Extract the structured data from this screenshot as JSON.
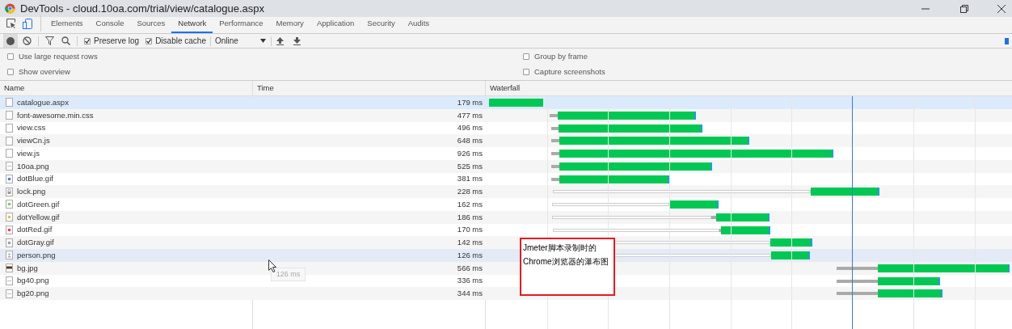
{
  "window": {
    "title": "DevTools - cloud.10oa.com/trial/view/catalogue.aspx"
  },
  "tabs": [
    {
      "label": "Elements",
      "selected": false
    },
    {
      "label": "Console",
      "selected": false
    },
    {
      "label": "Sources",
      "selected": false
    },
    {
      "label": "Network",
      "selected": true
    },
    {
      "label": "Performance",
      "selected": false
    },
    {
      "label": "Memory",
      "selected": false
    },
    {
      "label": "Application",
      "selected": false
    },
    {
      "label": "Security",
      "selected": false
    },
    {
      "label": "Audits",
      "selected": false
    }
  ],
  "toolbar": {
    "recording": true,
    "preserve_log": {
      "label": "Preserve log",
      "checked": true
    },
    "disable_cache": {
      "label": "Disable cache",
      "checked": true
    },
    "throttling": "Online"
  },
  "options": [
    {
      "label": "Use large request rows",
      "checked": false
    },
    {
      "label": "Group by frame",
      "checked": false
    },
    {
      "label": "Show overview",
      "checked": false
    },
    {
      "label": "Capture screenshots",
      "checked": false
    }
  ],
  "table": {
    "columns": [
      "Name",
      "Time",
      "Waterfall"
    ],
    "rows": [
      {
        "name": "catalogue.aspx",
        "time": "179 ms",
        "kind": "doc",
        "selected": true,
        "hovered": false
      },
      {
        "name": "font-awesome.min.css",
        "time": "477 ms",
        "kind": "doc",
        "selected": false,
        "hovered": false
      },
      {
        "name": "view.css",
        "time": "496 ms",
        "kind": "doc",
        "selected": false,
        "hovered": false
      },
      {
        "name": "viewCn.js",
        "time": "648 ms",
        "kind": "doc",
        "selected": false,
        "hovered": false
      },
      {
        "name": "view.js",
        "time": "926 ms",
        "kind": "doc",
        "selected": false,
        "hovered": false
      },
      {
        "name": "10oa.png",
        "time": "525 ms",
        "kind": "line",
        "selected": false,
        "hovered": false
      },
      {
        "name": "dotBlue.gif",
        "time": "381 ms",
        "kind": "dot",
        "color": "#4f6fd8",
        "selected": false,
        "hovered": false
      },
      {
        "name": "lock.png",
        "time": "228 ms",
        "kind": "lock",
        "selected": false,
        "hovered": false
      },
      {
        "name": "dotGreen.gif",
        "time": "162 ms",
        "kind": "dot",
        "color": "#7cc94a",
        "selected": false,
        "hovered": false
      },
      {
        "name": "dotYellow.gif",
        "time": "186 ms",
        "kind": "dot",
        "color": "#f2b43a",
        "selected": false,
        "hovered": false
      },
      {
        "name": "dotRed.gif",
        "time": "170 ms",
        "kind": "dot",
        "color": "#e8383d",
        "selected": false,
        "hovered": false
      },
      {
        "name": "dotGray.gif",
        "time": "142 ms",
        "kind": "dot",
        "color": "#9a9a9a",
        "selected": false,
        "hovered": false
      },
      {
        "name": "person.png",
        "time": "126 ms",
        "kind": "person",
        "selected": false,
        "hovered": true
      },
      {
        "name": "bg.jpg",
        "time": "566 ms",
        "kind": "photo",
        "selected": false,
        "hovered": false
      },
      {
        "name": "bg40.png",
        "time": "336 ms",
        "kind": "line",
        "selected": false,
        "hovered": false
      },
      {
        "name": "bg20.png",
        "time": "344 ms",
        "kind": "line",
        "selected": false,
        "hovered": false
      }
    ]
  },
  "tooltip": "126 ms",
  "annotation": {
    "lines": [
      "Jmeter脚本录制时的",
      "Chrome浏览器的瀑布图"
    ]
  }
}
